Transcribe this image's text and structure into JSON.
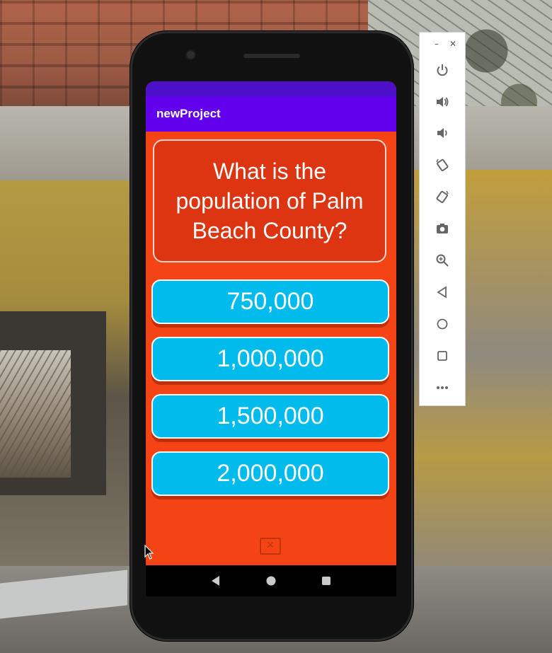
{
  "app": {
    "title": "newProject",
    "question": "What is the population of Palm Beach County?",
    "answers": [
      "750,000",
      "1,000,000",
      "1,500,000",
      "2,000,000"
    ]
  },
  "colors": {
    "status_bar": "#4c10c8",
    "app_bar": "#6200ee",
    "screen_background": "#f44416",
    "question_card": "#dd3411",
    "answer_button": "#00bbec"
  },
  "emulator_toolbar": {
    "window_controls": [
      "minimize-icon",
      "close-icon"
    ],
    "items": [
      "power-icon",
      "volume-up-icon",
      "volume-down-icon",
      "rotate-left-icon",
      "rotate-right-icon",
      "camera-icon",
      "zoom-icon",
      "back-icon",
      "home-icon",
      "overview-icon",
      "more-icon"
    ],
    "minimize_glyph": "–",
    "close_glyph": "✕"
  },
  "nav_bar": {
    "buttons": [
      "back-icon",
      "home-icon",
      "recents-icon"
    ]
  },
  "broken_image_glyph": "✕"
}
